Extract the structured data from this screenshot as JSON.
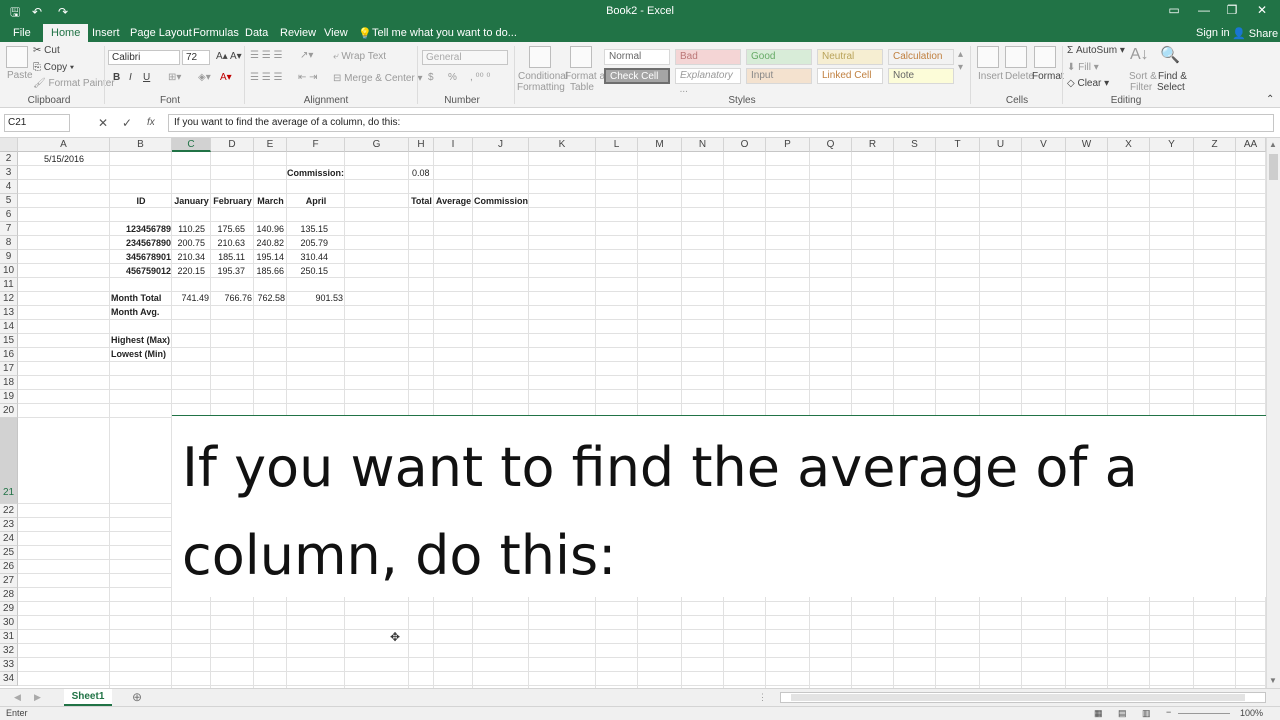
{
  "window": {
    "title": "Book2 - Excel"
  },
  "quick_access": {
    "save_icon": "save-icon",
    "undo_icon": "undo-icon",
    "redo_icon": "redo-icon"
  },
  "tabs": [
    "File",
    "Home",
    "Insert",
    "Page Layout",
    "Formulas",
    "Data",
    "Review",
    "View"
  ],
  "tell_me": "Tell me what you want to do...",
  "account": {
    "sign_in": "Sign in",
    "share": "Share"
  },
  "ribbon": {
    "clipboard": {
      "paste": "Paste",
      "cut": "Cut",
      "copy": "Copy",
      "format_painter": "Format Painter",
      "label": "Clipboard"
    },
    "font": {
      "name": "Calibri",
      "size": "72",
      "label": "Font",
      "bold": "B",
      "italic": "I",
      "underline": "U"
    },
    "alignment": {
      "wrap_text": "Wrap Text",
      "merge_center": "Merge & Center",
      "label": "Alignment"
    },
    "number": {
      "format": "General",
      "currency": "$",
      "percent": "%",
      "label": "Number"
    },
    "styles": {
      "cond_format_1": "Conditional",
      "cond_format_2": "Formatting",
      "format_table_1": "Format as",
      "format_table_2": "Table",
      "normal": "Normal",
      "bad": "Bad",
      "good": "Good",
      "neutral": "Neutral",
      "calculation": "Calculation",
      "check_cell": "Check Cell",
      "explanatory": "Explanatory ...",
      "input": "Input",
      "linked_cell": "Linked Cell",
      "note": "Note",
      "label": "Styles"
    },
    "cells": {
      "insert": "Insert",
      "delete": "Delete",
      "format": "Format",
      "label": "Cells"
    },
    "editing": {
      "autosum": "AutoSum",
      "fill": "Fill",
      "clear": "Clear",
      "sort_1": "Sort &",
      "sort_2": "Filter",
      "find_1": "Find &",
      "find_2": "Select",
      "label": "Editing"
    }
  },
  "formula_bar": {
    "name_box": "C21",
    "cancel": "✕",
    "enter": "✓",
    "fx": "fx",
    "content": "If you want to find the average of a column, do this:"
  },
  "columns": [
    "A",
    "B",
    "C",
    "D",
    "E",
    "F",
    "G",
    "H",
    "I",
    "J",
    "K",
    "L",
    "M",
    "N",
    "O",
    "P",
    "Q",
    "R",
    "S",
    "T",
    "U",
    "V",
    "W",
    "X",
    "Y",
    "Z",
    "AA"
  ],
  "rows": [
    "2",
    "3",
    "4",
    "5",
    "6",
    "7",
    "8",
    "9",
    "10",
    "11",
    "12",
    "13",
    "14",
    "15",
    "16",
    "17",
    "18",
    "19",
    "20",
    "21",
    "22",
    "23",
    "24",
    "25",
    "26",
    "27",
    "28",
    "29",
    "30",
    "31",
    "32",
    "33",
    "34"
  ],
  "sheet": {
    "a2": "5/15/2016",
    "f3": "Commission:",
    "h3": "0.08",
    "headers": {
      "id": "ID",
      "january": "January",
      "february": "February",
      "march": "March",
      "april": "April",
      "total": "Total",
      "average": "Average",
      "commission": "Commission"
    },
    "data_rows": [
      {
        "id": "123456789",
        "jan": "110.25",
        "feb": "175.65",
        "mar": "140.96",
        "apr": "135.15"
      },
      {
        "id": "234567890",
        "jan": "200.75",
        "feb": "210.63",
        "mar": "240.82",
        "apr": "205.79"
      },
      {
        "id": "345678901",
        "jan": "210.34",
        "feb": "185.11",
        "mar": "195.14",
        "apr": "310.44"
      },
      {
        "id": "456759012",
        "jan": "220.15",
        "feb": "195.37",
        "mar": "185.66",
        "apr": "250.15"
      }
    ],
    "month_total": {
      "label": "Month Total",
      "jan": "741.49",
      "feb": "766.76",
      "mar": "762.58",
      "apr": "901.53"
    },
    "month_avg": "Month Avg.",
    "highest": "Highest (Max)",
    "lowest": "Lowest (Min)",
    "editing_text": "If you want to find the average of a column, do this:"
  },
  "sheet_tabs": [
    "Sheet1"
  ],
  "status": {
    "mode": "Enter",
    "zoom": "100%"
  },
  "colors": {
    "accent": "#217346"
  }
}
